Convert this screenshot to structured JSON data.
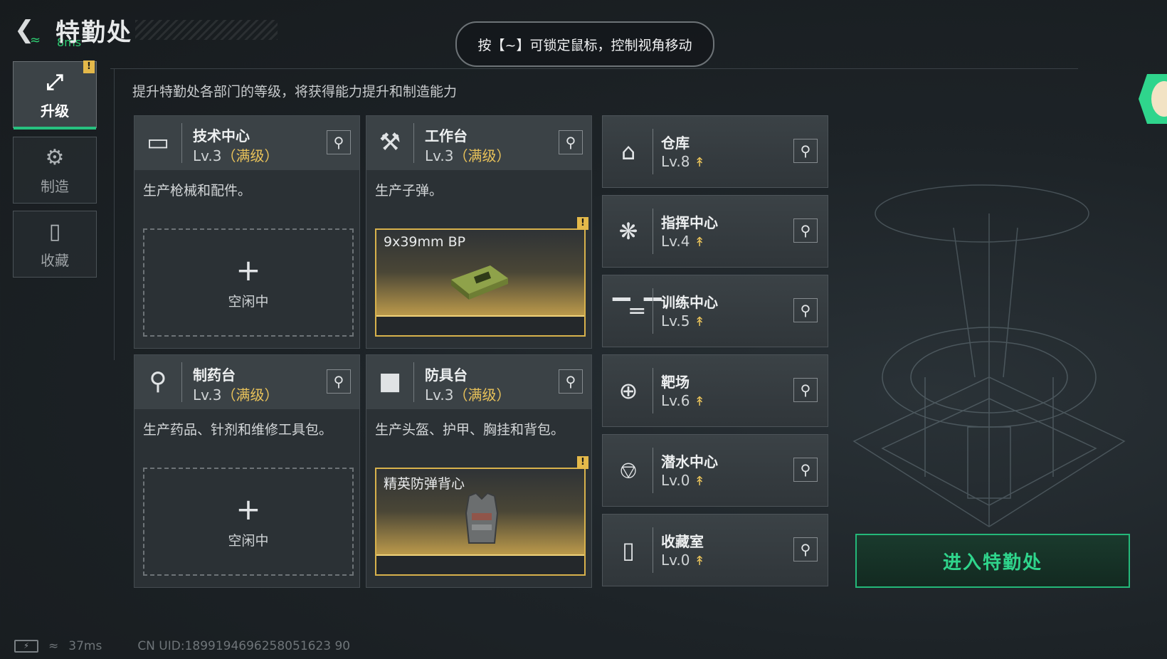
{
  "header": {
    "title": "特勤处",
    "ping_small": "8ms",
    "hint": "按【~】可锁定鼠标，控制视角移动"
  },
  "sidebar": {
    "items": [
      {
        "label": "升级",
        "active": true,
        "badge": "!"
      },
      {
        "label": "制造"
      },
      {
        "label": "收藏"
      }
    ]
  },
  "main": {
    "description": "提升特勤处各部门的等级，将获得能力提升和制造能力",
    "cards": [
      {
        "name": "技术中心",
        "level": "Lv.3",
        "max": "（满级）",
        "text": "生产枪械和配件。",
        "slot_status": "空闲中",
        "icon": "tech-center-icon"
      },
      {
        "name": "工作台",
        "level": "Lv.3",
        "max": "（满级）",
        "text": "生产子弹。",
        "slot_item": "9x39mm BP",
        "badge": "!",
        "icon": "workbench-icon"
      },
      {
        "name": "制药台",
        "level": "Lv.3",
        "max": "（满级）",
        "text": "生产药品、针剂和维修工具包。",
        "slot_status": "空闲中",
        "icon": "pharmacy-icon"
      },
      {
        "name": "防具台",
        "level": "Lv.3",
        "max": "（满级）",
        "text": "生产头盔、护甲、胸挂和背包。",
        "slot_item": "精英防弹背心",
        "badge": "!",
        "icon": "armor-bench-icon"
      }
    ],
    "rows": [
      {
        "name": "仓库",
        "level": "Lv.8",
        "icon": "warehouse-icon"
      },
      {
        "name": "指挥中心",
        "level": "Lv.4",
        "icon": "command-center-icon"
      },
      {
        "name": "训练中心",
        "level": "Lv.5",
        "icon": "training-center-icon"
      },
      {
        "name": "靶场",
        "level": "Lv.6",
        "icon": "shooting-range-icon"
      },
      {
        "name": "潜水中心",
        "level": "Lv.0",
        "icon": "diving-center-icon"
      },
      {
        "name": "收藏室",
        "level": "Lv.0",
        "icon": "collection-room-icon"
      }
    ],
    "enter_button": "进入特勤处"
  },
  "footer": {
    "ping": "37ms",
    "uid": "CN UID:1899194696258051623 90"
  },
  "colors": {
    "accent_green": "#2fd58c",
    "gold": "#e8c25a",
    "badge": "#e4b94a"
  }
}
